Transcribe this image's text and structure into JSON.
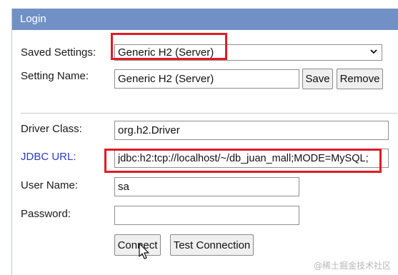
{
  "window": {
    "title": "Login"
  },
  "saved_settings": {
    "label": "Saved Settings:",
    "value": "Generic H2 (Server)"
  },
  "setting_name": {
    "label": "Setting Name:",
    "value": "Generic H2 (Server)",
    "save_label": "Save",
    "remove_label": "Remove"
  },
  "driver_class": {
    "label": "Driver Class:",
    "value": "org.h2.Driver"
  },
  "jdbc_url": {
    "label": "JDBC URL:",
    "value": "jdbc:h2:tcp://localhost/~/db_juan_mall;MODE=MySQL;"
  },
  "user_name": {
    "label": "User Name:",
    "value": "sa"
  },
  "password": {
    "label": "Password:",
    "value": ""
  },
  "actions": {
    "connect_label": "Connect",
    "test_label": "Test Connection"
  },
  "watermark": "@稀土掘金技术社区",
  "colors": {
    "titlebar": "#7191c6",
    "highlight": "#e21b25",
    "link": "#2b3cc2"
  }
}
